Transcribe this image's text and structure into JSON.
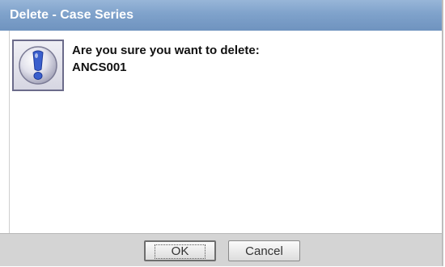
{
  "window": {
    "title": "Delete - Case Series"
  },
  "message": {
    "question": "Are you sure you want to delete:",
    "item_name": "ANCS001",
    "icon": "exclamation-info-icon"
  },
  "buttons": {
    "ok_label": "OK",
    "cancel_label": "Cancel"
  },
  "colors": {
    "titlebar": "#7fa2cb",
    "title_text": "#ffffff",
    "footer": "#d4d4d4",
    "icon_accent": "#3a5fcd"
  }
}
